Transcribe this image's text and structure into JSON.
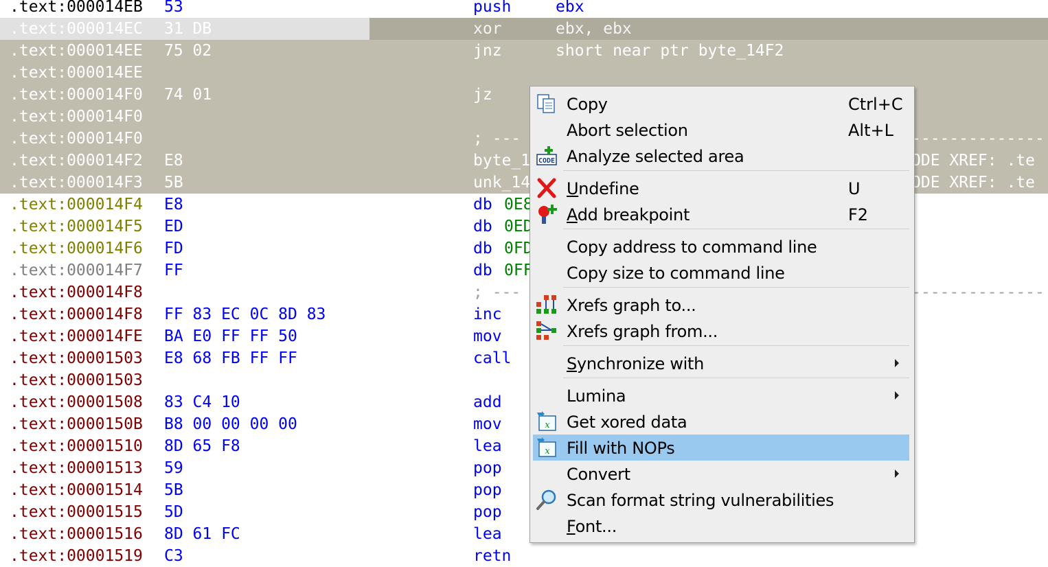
{
  "disasm": {
    "lines": [
      {
        "addr": ".text:000014EB",
        "bytes": "53",
        "mnem": "push",
        "ops": "ebx",
        "comment": "",
        "extra": ""
      },
      {
        "addr": ".text:000014EC",
        "bytes": "31 DB",
        "mnem": "xor",
        "ops": "ebx, ebx",
        "comment": "",
        "extra": ""
      },
      {
        "addr": ".text:000014EE",
        "bytes": "75 02",
        "mnem": "jnz",
        "ops": "short near ptr byte_14F2",
        "comment": "",
        "extra": ""
      },
      {
        "addr": ".text:000014EE",
        "bytes": "",
        "mnem": "",
        "ops": "",
        "comment": "",
        "extra": ""
      },
      {
        "addr": ".text:000014F0",
        "bytes": "74 01",
        "mnem": "jz",
        "ops": "",
        "comment": "",
        "extra": ""
      },
      {
        "addr": ".text:000014F0",
        "bytes": "",
        "mnem": "",
        "ops": "",
        "comment": "",
        "extra": ""
      },
      {
        "addr": ".text:000014F0",
        "bytes": "",
        "mnem": "",
        "ops": "",
        "comment": "; ---",
        "extra": "--------------"
      },
      {
        "addr": ".text:000014F2",
        "bytes": "E8",
        "mnem": "byte_1",
        "ops": "",
        "comment": "",
        "extra": "ODE XREF: .te"
      },
      {
        "addr": ".text:000014F3",
        "bytes": "5B",
        "mnem": "unk_14",
        "ops": "",
        "comment": "",
        "extra": "ODE XREF: .te"
      },
      {
        "addr": ".text:000014F4",
        "bytes": "E8",
        "mnem": "db",
        "ops": "0E8",
        "comment": "",
        "extra": ""
      },
      {
        "addr": ".text:000014F5",
        "bytes": "ED",
        "mnem": "db",
        "ops": "0ED",
        "comment": "",
        "extra": ""
      },
      {
        "addr": ".text:000014F6",
        "bytes": "FD",
        "mnem": "db",
        "ops": "0FD",
        "comment": "",
        "extra": ""
      },
      {
        "addr": ".text:000014F7",
        "bytes": "FF",
        "mnem": "db",
        "ops": "0FF",
        "comment": "",
        "extra": ""
      },
      {
        "addr": ".text:000014F8",
        "bytes": "",
        "mnem": "",
        "ops": "",
        "comment": "; ---",
        "extra": "--------------"
      },
      {
        "addr": ".text:000014F8",
        "bytes": "FF 83 EC 0C 8D 83",
        "mnem": "inc",
        "ops": "",
        "comment": "",
        "extra": ""
      },
      {
        "addr": ".text:000014FE",
        "bytes": "BA E0 FF FF 50",
        "mnem": "mov",
        "ops": "",
        "comment": "",
        "extra": ""
      },
      {
        "addr": ".text:00001503",
        "bytes": "E8 68 FB FF FF",
        "mnem": "call",
        "ops": "",
        "comment": "",
        "extra": ""
      },
      {
        "addr": ".text:00001503",
        "bytes": "",
        "mnem": "",
        "ops": "",
        "comment": "",
        "extra": ""
      },
      {
        "addr": ".text:00001508",
        "bytes": "83 C4 10",
        "mnem": "add",
        "ops": "",
        "comment": "",
        "extra": ""
      },
      {
        "addr": ".text:0000150B",
        "bytes": "B8 00 00 00 00",
        "mnem": "mov",
        "ops": "",
        "comment": "",
        "extra": ""
      },
      {
        "addr": ".text:00001510",
        "bytes": "8D 65 F8",
        "mnem": "lea",
        "ops": "",
        "comment": "",
        "extra": ""
      },
      {
        "addr": ".text:00001513",
        "bytes": "59",
        "mnem": "pop",
        "ops": "",
        "comment": "",
        "extra": ""
      },
      {
        "addr": ".text:00001514",
        "bytes": "5B",
        "mnem": "pop",
        "ops": "",
        "comment": "",
        "extra": ""
      },
      {
        "addr": ".text:00001515",
        "bytes": "5D",
        "mnem": "pop",
        "ops": "",
        "comment": "",
        "extra": ""
      },
      {
        "addr": ".text:00001516",
        "bytes": "8D 61 FC",
        "mnem": "lea",
        "ops": "",
        "comment": "",
        "extra": ""
      },
      {
        "addr": ".text:00001519",
        "bytes": "C3",
        "mnem": "retn",
        "ops": "",
        "comment": "",
        "extra": ""
      }
    ]
  },
  "context_menu": {
    "items": [
      {
        "pre": "",
        "ul": "",
        "post": "Copy",
        "shortcut": "Ctrl+C",
        "icon": "copy-icon",
        "submenu": false,
        "highlighted": false
      },
      {
        "pre": "",
        "ul": "",
        "post": "Abort selection",
        "shortcut": "Alt+L",
        "icon": "",
        "submenu": false,
        "highlighted": false
      },
      {
        "pre": "",
        "ul": "",
        "post": "Analyze selected area",
        "shortcut": "",
        "icon": "code-icon",
        "submenu": false,
        "highlighted": false
      },
      {
        "pre": "",
        "ul": "U",
        "post": "ndefine",
        "shortcut": "U",
        "icon": "delete-icon",
        "submenu": false,
        "highlighted": false
      },
      {
        "pre": "",
        "ul": "A",
        "post": "dd breakpoint",
        "shortcut": "F2",
        "icon": "breakpoint-icon",
        "submenu": false,
        "highlighted": false
      },
      {
        "pre": "",
        "ul": "",
        "post": "Copy address to command line",
        "shortcut": "",
        "icon": "",
        "submenu": false,
        "highlighted": false
      },
      {
        "pre": "",
        "ul": "",
        "post": "Copy size to command line",
        "shortcut": "",
        "icon": "",
        "submenu": false,
        "highlighted": false
      },
      {
        "pre": "",
        "ul": "",
        "post": "Xrefs graph to...",
        "shortcut": "",
        "icon": "xrefs-to-icon",
        "submenu": false,
        "highlighted": false
      },
      {
        "pre": "",
        "ul": "",
        "post": "Xrefs graph from...",
        "shortcut": "",
        "icon": "xrefs-from-icon",
        "submenu": false,
        "highlighted": false
      },
      {
        "pre": "",
        "ul": "S",
        "post": "ynchronize with",
        "shortcut": "",
        "icon": "",
        "submenu": true,
        "highlighted": false
      },
      {
        "pre": "",
        "ul": "",
        "post": "Lumina",
        "shortcut": "",
        "icon": "",
        "submenu": true,
        "highlighted": false
      },
      {
        "pre": "",
        "ul": "",
        "post": "Get xored data",
        "shortcut": "",
        "icon": "script-icon",
        "submenu": false,
        "highlighted": false
      },
      {
        "pre": "",
        "ul": "",
        "post": "Fill with NOPs",
        "shortcut": "",
        "icon": "script-icon",
        "submenu": false,
        "highlighted": true
      },
      {
        "pre": "",
        "ul": "",
        "post": "Convert",
        "shortcut": "",
        "icon": "",
        "submenu": true,
        "highlighted": false
      },
      {
        "pre": "",
        "ul": "",
        "post": "Scan format string vulnerabilities",
        "shortcut": "",
        "icon": "magnifier-icon",
        "submenu": false,
        "highlighted": false
      },
      {
        "pre": "",
        "ul": "F",
        "post": "ont...",
        "shortcut": "",
        "icon": "",
        "submenu": false,
        "highlighted": false
      }
    ]
  }
}
